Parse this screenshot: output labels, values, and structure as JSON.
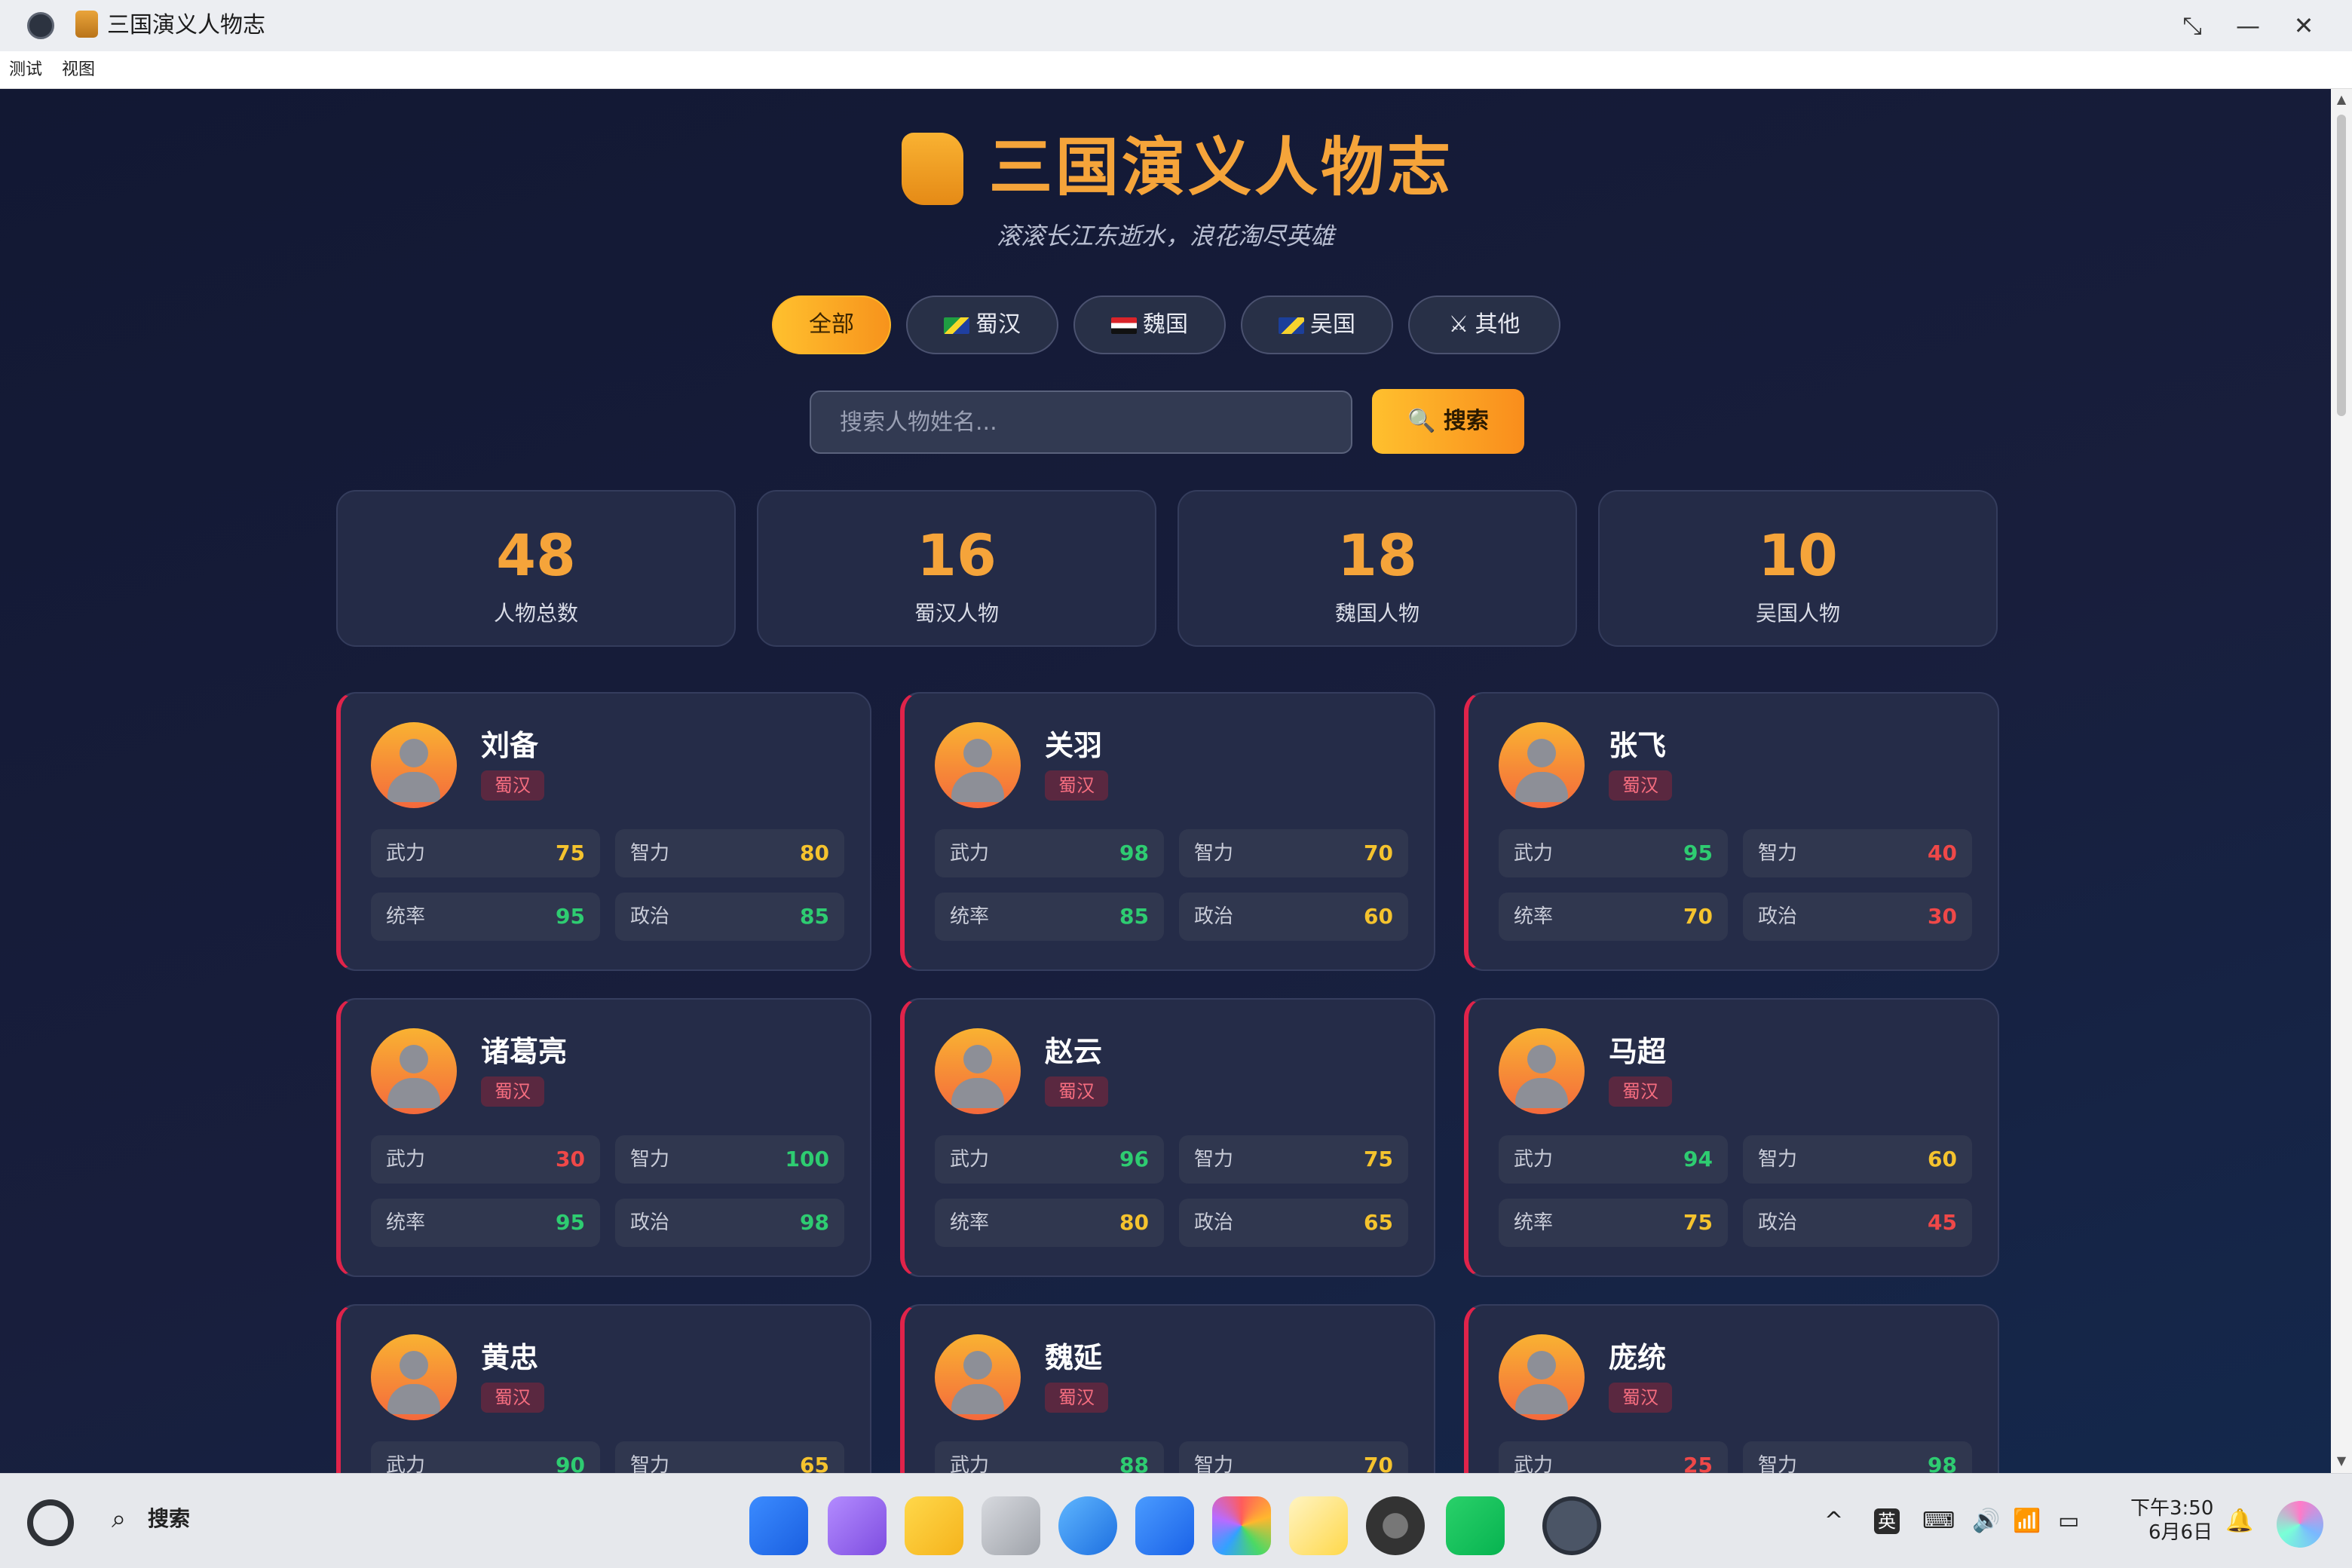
{
  "window": {
    "title": "三国演义人物志"
  },
  "menu": [
    "测试",
    "视图"
  ],
  "header": {
    "title": "三国演义人物志",
    "subtitle": "滚滚长江东逝水，浪花淘尽英雄"
  },
  "filters": [
    {
      "label": "全部",
      "active": true
    },
    {
      "label": "蜀汉",
      "flag": "flag-icon"
    },
    {
      "label": "魏国",
      "flag": "flag-icon"
    },
    {
      "label": "吴国",
      "flag": "flag-icon"
    },
    {
      "label": "其他",
      "flag": "crossed-swords-icon"
    }
  ],
  "search": {
    "placeholder": "搜索人物姓名...",
    "button_label": "搜索"
  },
  "stats": [
    {
      "value": "48",
      "label": "人物总数"
    },
    {
      "value": "16",
      "label": "蜀汉人物"
    },
    {
      "value": "18",
      "label": "魏国人物"
    },
    {
      "value": "10",
      "label": "吴国人物"
    }
  ],
  "stat_labels": {
    "force": "武力",
    "intel": "智力",
    "lead": "统率",
    "politics": "政治"
  },
  "characters": [
    {
      "name": "刘备",
      "faction": "蜀汉",
      "force": "75",
      "intel": "80",
      "lead": "95",
      "politics": "85"
    },
    {
      "name": "关羽",
      "faction": "蜀汉",
      "force": "98",
      "intel": "70",
      "lead": "85",
      "politics": "60"
    },
    {
      "name": "张飞",
      "faction": "蜀汉",
      "force": "95",
      "intel": "40",
      "lead": "70",
      "politics": "30"
    },
    {
      "name": "诸葛亮",
      "faction": "蜀汉",
      "force": "30",
      "intel": "100",
      "lead": "95",
      "politics": "98"
    },
    {
      "name": "赵云",
      "faction": "蜀汉",
      "force": "96",
      "intel": "75",
      "lead": "80",
      "politics": "65"
    },
    {
      "name": "马超",
      "faction": "蜀汉",
      "force": "94",
      "intel": "60",
      "lead": "75",
      "politics": "45"
    },
    {
      "name": "黄忠",
      "faction": "蜀汉",
      "force": "90",
      "intel": "65"
    },
    {
      "name": "魏延",
      "faction": "蜀汉",
      "force": "88",
      "intel": "70"
    },
    {
      "name": "庞统",
      "faction": "蜀汉",
      "force": "25",
      "intel": "98"
    }
  ],
  "taskbar": {
    "search_label": "搜索",
    "ime": "英",
    "time": "下午3:50",
    "date": "6月6日"
  },
  "colors": {
    "accent": "#f5a43a",
    "shu": "#e0234a",
    "high": "#2ecc71",
    "mid": "#f5c32e",
    "low": "#ef4848"
  }
}
